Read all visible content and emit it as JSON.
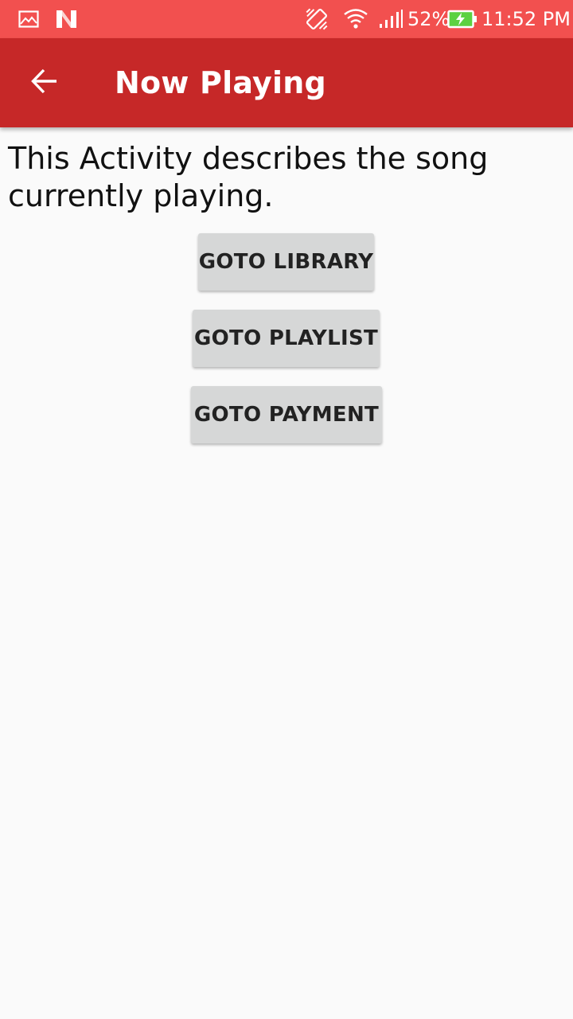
{
  "status_bar": {
    "battery_percent": "52%",
    "time": "11:52 PM",
    "left_icons": [
      "gallery-notification-icon",
      "n-notification-icon"
    ],
    "right_icons": [
      "vibrate-icon",
      "wifi-icon",
      "cell-signal-icon",
      "battery-charging-icon"
    ],
    "colors": {
      "background": "#f2504f"
    }
  },
  "app_bar": {
    "title": "Now Playing",
    "nav_icon": "back-arrow-icon",
    "colors": {
      "background": "#c62828",
      "text": "#ffffff"
    }
  },
  "main": {
    "description": "This Activity describes the song currently playing.",
    "buttons": [
      {
        "label": "GOTO LIBRARY"
      },
      {
        "label": "GOTO PLAYLIST"
      },
      {
        "label": "GOTO PAYMENT"
      }
    ],
    "colors": {
      "button_background": "#d6d7d7",
      "button_text": "#222222",
      "page_background": "#fafafa"
    }
  }
}
